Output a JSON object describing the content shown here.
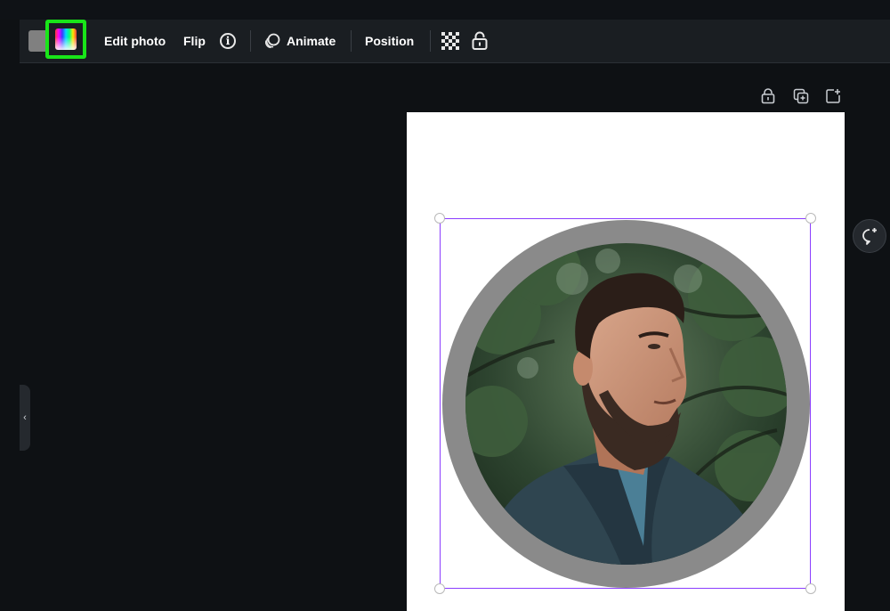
{
  "toolbar": {
    "edit_photo_label": "Edit photo",
    "flip_label": "Flip",
    "animate_label": "Animate",
    "position_label": "Position",
    "icons": {
      "color": "color-picker-icon",
      "info": "info-icon",
      "animate": "animate-icon",
      "transparency": "transparency-icon",
      "lock": "lock-icon"
    },
    "highlight_color": "#19e619",
    "swatch_color": "#808080"
  },
  "canvas_actions": {
    "icons": [
      "lock-icon",
      "duplicate-page-icon",
      "add-page-icon"
    ]
  },
  "side_tab": {
    "glyph": "‹"
  },
  "selection": {
    "accent_color": "#8b3dff"
  },
  "frame": {
    "ring_color": "#8a8a8a"
  }
}
